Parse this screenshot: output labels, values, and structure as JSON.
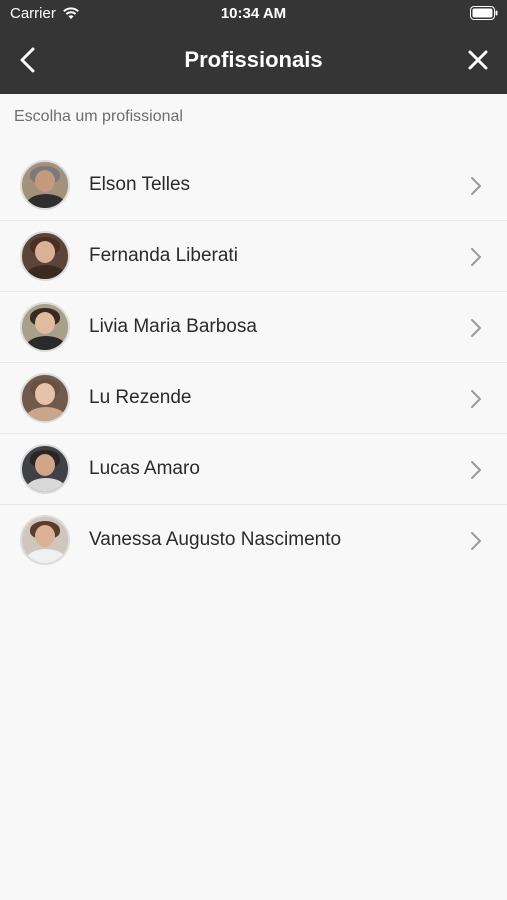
{
  "status_bar": {
    "carrier": "Carrier",
    "time": "10:34 AM"
  },
  "nav": {
    "title": "Profissionais",
    "back_icon": "chevron-left-icon",
    "close_icon": "close-icon"
  },
  "section_label": "Escolha um profissional",
  "professionals": [
    {
      "name": "Elson Telles",
      "bg": "#a4917c",
      "face": "#c49a7e",
      "hair": "#7a7a7a",
      "body": "#2e2e2e"
    },
    {
      "name": "Fernanda Liberati",
      "bg": "#5a4538",
      "face": "#d9b195",
      "hair": "#4a3022",
      "body": "#3b2a20"
    },
    {
      "name": "Livia Maria Barbosa",
      "bg": "#a8a08a",
      "face": "#e0bba0",
      "hair": "#3a2a22",
      "body": "#2a2a2a"
    },
    {
      "name": "Lu Rezende",
      "bg": "#705a4e",
      "face": "#e6c3a8",
      "hair": "#6a5040",
      "body": "#c9a58c"
    },
    {
      "name": "Lucas Amaro",
      "bg": "#3f4146",
      "face": "#d1a585",
      "hair": "#2a2520",
      "body": "#d8d8d8"
    },
    {
      "name": "Vanessa Augusto Nascimento",
      "bg": "#cfc7bd",
      "face": "#dcb296",
      "hair": "#5a3e2c",
      "body": "#f0f0f0"
    }
  ]
}
